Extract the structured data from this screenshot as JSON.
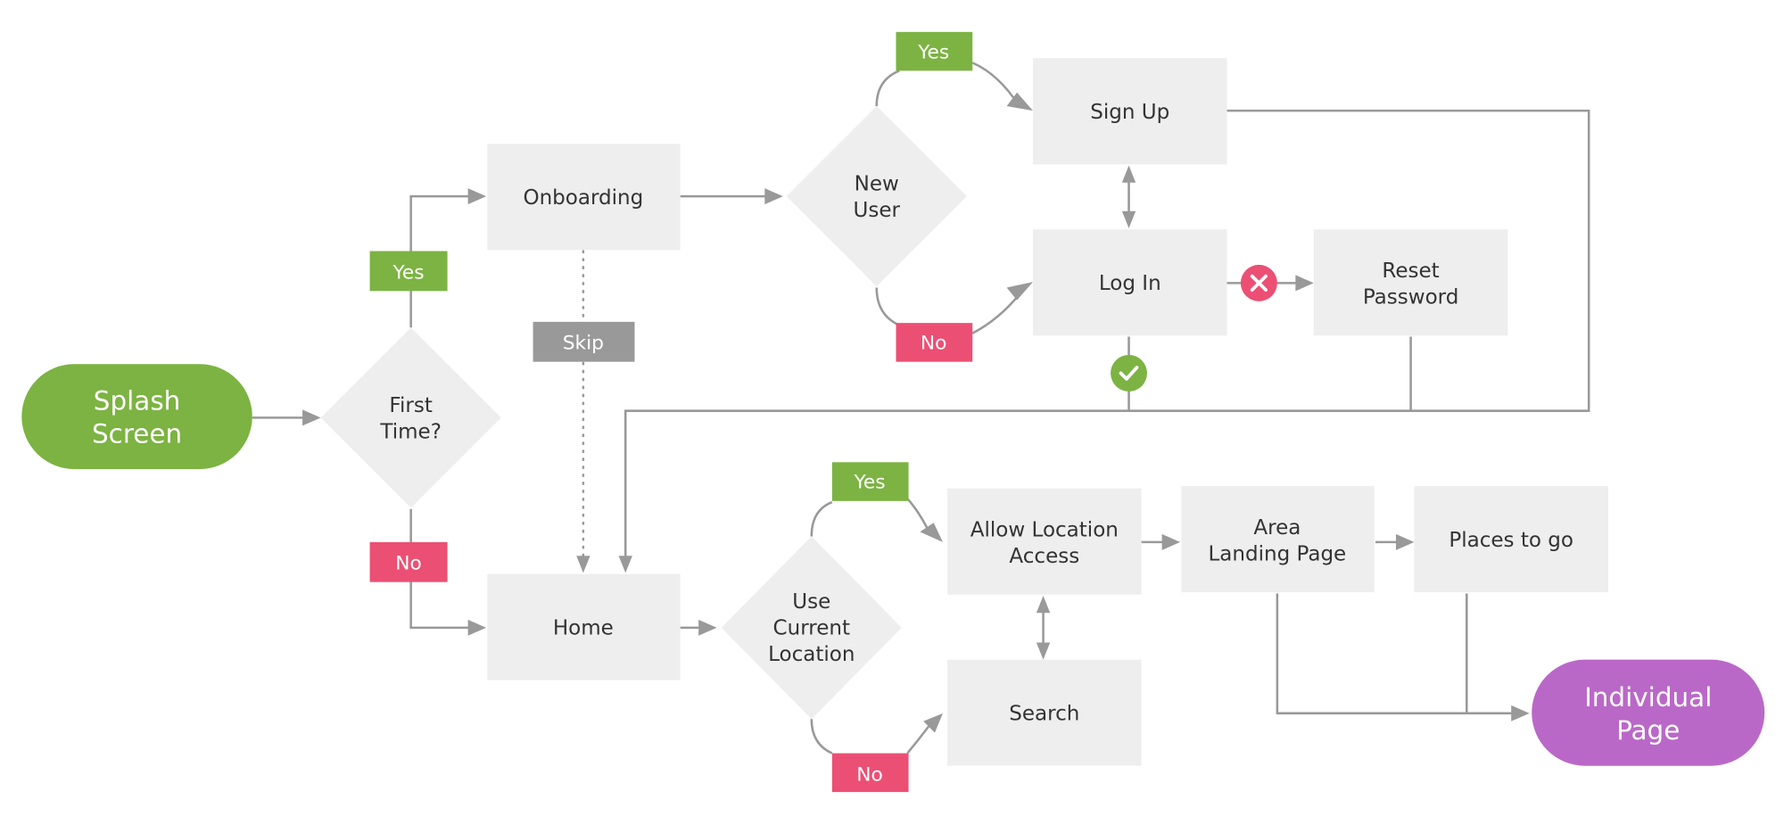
{
  "diagram": {
    "type": "user-flow",
    "colors": {
      "start_terminal": "#7cb342",
      "end_terminal": "#ba68c8",
      "process_box": "#eeeeee",
      "decision": "#eeeeee",
      "yes_tag": "#7cb342",
      "no_tag": "#ec4f74",
      "skip_tag": "#999999",
      "connector": "#999999",
      "text_dark": "#333333",
      "text_light": "#ffffff"
    },
    "nodes": {
      "splash": {
        "line1": "Splash",
        "line2": "Screen"
      },
      "first_time": {
        "line1": "First",
        "line2": "Time?"
      },
      "onboarding": {
        "label": "Onboarding"
      },
      "new_user": {
        "line1": "New",
        "line2": "User"
      },
      "sign_up": {
        "label": "Sign Up"
      },
      "log_in": {
        "label": "Log In"
      },
      "reset_password": {
        "line1": "Reset",
        "line2": "Password"
      },
      "home": {
        "label": "Home"
      },
      "use_current_location": {
        "line1": "Use",
        "line2": "Current",
        "line3": "Location"
      },
      "allow_location": {
        "line1": "Allow Location",
        "line2": "Access"
      },
      "search": {
        "label": "Search"
      },
      "area_landing": {
        "line1": "Area",
        "line2": "Landing Page"
      },
      "places_to_go": {
        "label": "Places to go"
      },
      "individual_page": {
        "line1": "Individual",
        "line2": "Page"
      }
    },
    "tags": {
      "first_time_yes": "Yes",
      "first_time_no": "No",
      "skip": "Skip",
      "new_user_yes": "Yes",
      "new_user_no": "No",
      "location_yes": "Yes",
      "location_no": "No"
    },
    "status_icons": {
      "login_fail": "close-icon",
      "login_success": "check-icon"
    },
    "edges": [
      {
        "from": "Splash Screen",
        "to": "First Time?"
      },
      {
        "from": "First Time?",
        "to": "Onboarding",
        "label": "Yes"
      },
      {
        "from": "First Time?",
        "to": "Home",
        "label": "No"
      },
      {
        "from": "Onboarding",
        "to": "Home",
        "label": "Skip",
        "style": "dotted"
      },
      {
        "from": "Onboarding",
        "to": "New User"
      },
      {
        "from": "New User",
        "to": "Sign Up",
        "label": "Yes"
      },
      {
        "from": "New User",
        "to": "Log In",
        "label": "No"
      },
      {
        "from": "Sign Up",
        "to": "Log In",
        "bidirectional": true
      },
      {
        "from": "Log In",
        "to": "Reset Password",
        "status": "fail"
      },
      {
        "from": "Log In",
        "to": "Home",
        "status": "success"
      },
      {
        "from": "Sign Up",
        "to": "Home"
      },
      {
        "from": "Reset Password",
        "to": "Home"
      },
      {
        "from": "Home",
        "to": "Use Current Location"
      },
      {
        "from": "Use Current Location",
        "to": "Allow Location Access",
        "label": "Yes"
      },
      {
        "from": "Use Current Location",
        "to": "Search",
        "label": "No"
      },
      {
        "from": "Allow Location Access",
        "to": "Search",
        "bidirectional": true
      },
      {
        "from": "Allow Location Access",
        "to": "Area Landing Page"
      },
      {
        "from": "Area Landing Page",
        "to": "Places to go"
      },
      {
        "from": "Area Landing Page",
        "to": "Individual Page"
      },
      {
        "from": "Places to go",
        "to": "Individual Page"
      }
    ]
  }
}
